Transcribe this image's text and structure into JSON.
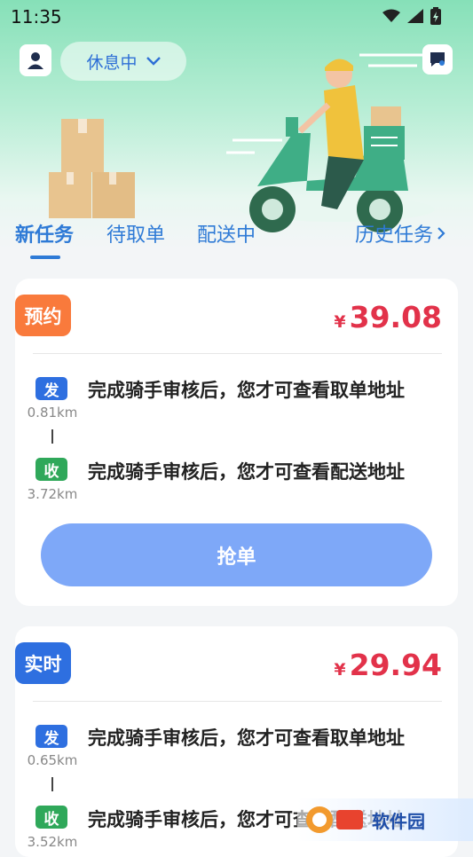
{
  "status_bar": {
    "time": "11:35"
  },
  "header": {
    "status_label": "休息中"
  },
  "tabs": [
    {
      "label": "新任务"
    },
    {
      "label": "待取单"
    },
    {
      "label": "配送中"
    },
    {
      "label": "历史任务"
    }
  ],
  "orders": [
    {
      "badge": "预约",
      "badge_color": "#f97a3c",
      "currency": "¥",
      "price": "39.08",
      "pickup_tag": "发",
      "pickup_distance": "0.81km",
      "pickup_text": "完成骑手审核后，您才可查看取单地址",
      "delivery_tag": "收",
      "delivery_distance": "3.72km",
      "delivery_text": "完成骑手审核后，您才可查看配送地址",
      "grab_label": "抢单"
    },
    {
      "badge": "实时",
      "badge_color": "#2e6fe0",
      "currency": "¥",
      "price": "29.94",
      "pickup_tag": "发",
      "pickup_distance": "0.65km",
      "pickup_text": "完成骑手审核后，您才可查看取单地址",
      "delivery_tag": "收",
      "delivery_distance": "3.52km",
      "delivery_text": "完成骑手审核后，您才可查看配送地址"
    }
  ],
  "colors": {
    "primary": "#2e7ad6",
    "price": "#e2324a",
    "pickup_tag": "#2e6fe0",
    "delivery_tag": "#2fa85a"
  },
  "watermark": {
    "text": "软件园"
  }
}
